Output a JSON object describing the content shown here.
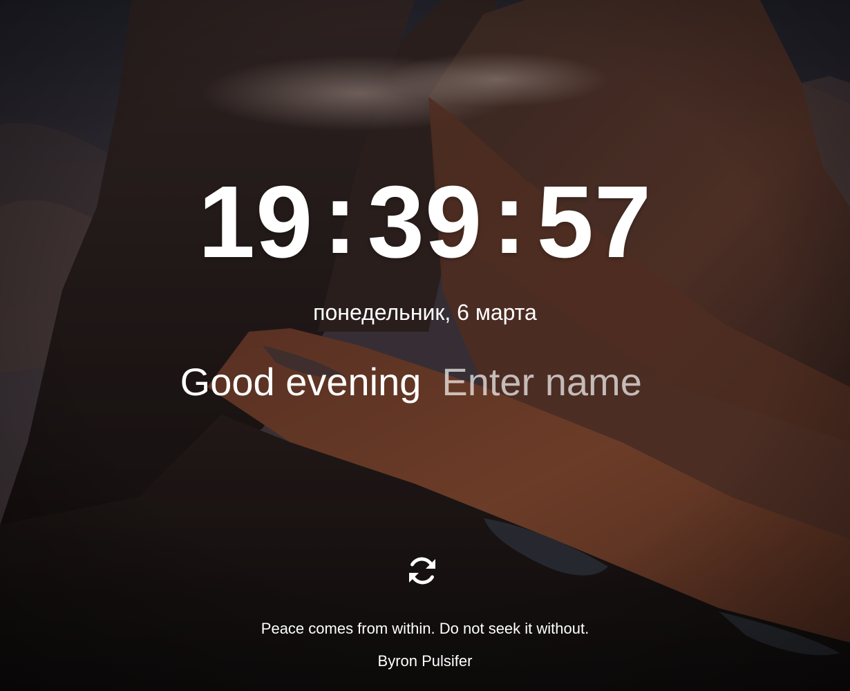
{
  "clock": {
    "hours": "19",
    "minutes": "39",
    "seconds": "57",
    "separator": ":"
  },
  "date": {
    "text": "понедельник, 6 марта"
  },
  "greeting": {
    "text": "Good evening",
    "name_placeholder": "Enter name",
    "name_value": ""
  },
  "quote": {
    "text": "Peace comes from within. Do not seek it without.",
    "author": "Byron Pulsifer"
  },
  "icons": {
    "refresh": "refresh-icon"
  },
  "colors": {
    "text": "#ffffff",
    "placeholder": "#c9bdbb",
    "sky": "#3a3a4a",
    "rock_dark": "#1e1718",
    "meadow": "#8a4a34"
  }
}
